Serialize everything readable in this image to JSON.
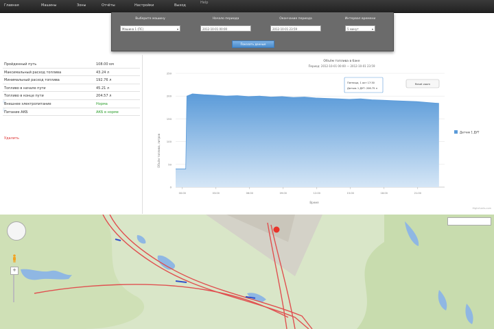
{
  "nav": {
    "items": [
      "Главная",
      "Машины",
      "Зоны",
      "Отчёты",
      "Настройки",
      "Выход",
      "Help"
    ]
  },
  "filter_panel": {
    "columns": [
      {
        "label": "Выберите машину",
        "value": "Машина 1 (ПС)"
      },
      {
        "label": "Начало периода",
        "value": "2012-10-01 00:00"
      },
      {
        "label": "Окончание периода",
        "value": "2012-10-01 23:59"
      },
      {
        "label": "Интервал времени",
        "value": "5 минут"
      }
    ],
    "apply_label": "Показать данные"
  },
  "stats": {
    "rows": [
      {
        "key": "Пройденный путь",
        "value": "108.00 км"
      },
      {
        "key": "Максимальный расход топлива",
        "value": "43.24 л"
      },
      {
        "key": "Минимальный расход топлива",
        "value": "192.76 л"
      },
      {
        "key": "Топливо в начале пути",
        "value": "45.21 л"
      },
      {
        "key": "Топливо в конце пути",
        "value": "204.57 л"
      },
      {
        "key": "Внешнее электропитание",
        "value": "Норма",
        "green": true,
        "help": true
      },
      {
        "key": "Питание АКБ",
        "value": "АКБ в норме",
        "green": true,
        "help": true
      }
    ],
    "delete_label": "Удалить"
  },
  "chart": {
    "title": "Объём топлива в баке",
    "subtitle": "Период: 2012-10-01 00:00 — 2012-10-01 23:59",
    "ylabel": "Объём топлива, литров",
    "xlabel": "Время",
    "legend": "Датчик 1 ДУТ",
    "reset_zoom": "Reset zoom",
    "tooltip_line1": "Пятница, 1 окт 17:30",
    "tooltip_line2": "Датчик 1 ДУТ: 206.75 л",
    "credit": "Highcharts.com",
    "series_color": "#5b9bd9",
    "series_color_light": "#d5e6f6"
  },
  "chart_data": {
    "type": "area",
    "y_ticks": [
      "250",
      "200",
      "150",
      "100",
      "50",
      "0"
    ],
    "ylim": [
      0,
      250
    ],
    "x_ticks": [
      "00:00",
      "03:00",
      "06:00",
      "09:00",
      "12:00",
      "15:00",
      "18:00",
      "21:00"
    ],
    "series": [
      {
        "name": "Датчик 1 ДУТ",
        "points": [
          [
            0.0,
            40
          ],
          [
            0.6,
            40
          ],
          [
            0.9,
            40
          ],
          [
            1.0,
            200
          ],
          [
            1.5,
            205
          ],
          [
            2.5,
            203
          ],
          [
            3.5,
            202
          ],
          [
            4.5,
            200
          ],
          [
            5.5,
            201
          ],
          [
            6.5,
            199
          ],
          [
            7.5,
            200
          ],
          [
            8.5,
            198
          ],
          [
            9.5,
            199
          ],
          [
            10.5,
            197
          ],
          [
            11.5,
            198
          ],
          [
            12.5,
            196
          ],
          [
            13.5,
            195
          ],
          [
            14.5,
            194
          ],
          [
            15.5,
            193
          ],
          [
            16.5,
            194
          ],
          [
            17.5,
            192
          ],
          [
            18.5,
            191
          ],
          [
            19.5,
            190
          ],
          [
            20.5,
            189
          ],
          [
            21.5,
            188
          ],
          [
            22.5,
            186
          ],
          [
            23.5,
            184
          ]
        ]
      }
    ]
  },
  "map": {
    "road_color": "#e05050",
    "marker_color": "#e8342a"
  }
}
